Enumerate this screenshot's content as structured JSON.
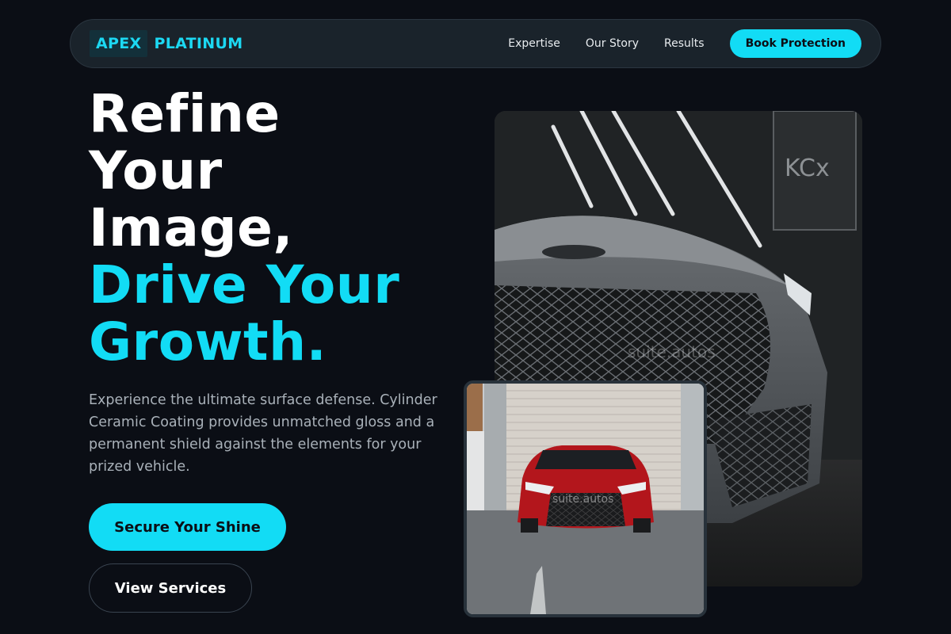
{
  "brand": {
    "part1": "APEX",
    "part2": "PLATINUM",
    "accent": "#12dcf5"
  },
  "nav": {
    "links": [
      "Expertise",
      "Our Story",
      "Results"
    ],
    "cta": "Book Protection"
  },
  "hero": {
    "title_lines": [
      "Refine",
      "Your",
      "Image,"
    ],
    "accent_lines": [
      "Drive Your",
      "Growth."
    ],
    "description": "Experience the ultimate surface defense. Cylinder Ceramic Coating provides unmatched gloss and a permanent shield against the elements for your prized vehicle.",
    "primary_button": "Secure Your Shine",
    "secondary_button": "View Services"
  },
  "images": {
    "main": {
      "subject": "grey sports car front grille under studio light bars",
      "sign_text": "KCx",
      "watermark": "suite.autos"
    },
    "small": {
      "subject": "red sedan parked in front of garage door",
      "watermark": "suite.autos"
    }
  }
}
